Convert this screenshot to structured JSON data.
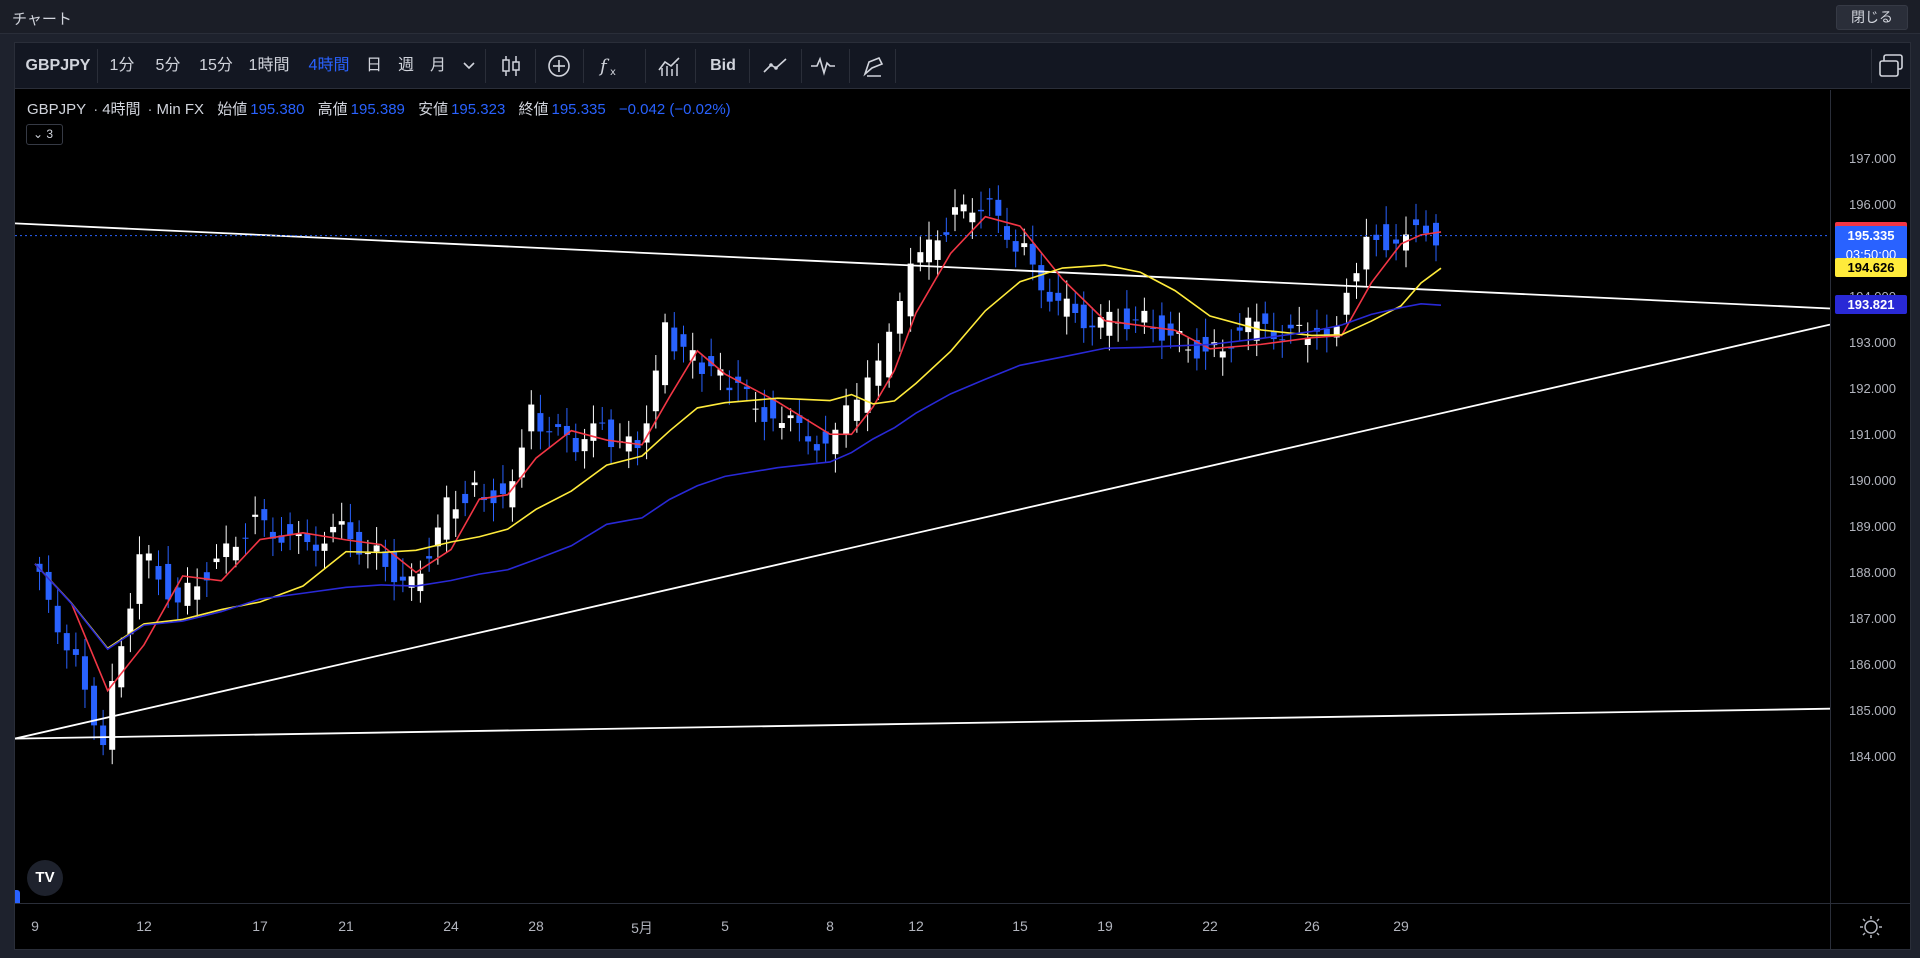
{
  "window": {
    "title": "チャート",
    "close_label": "閉じる"
  },
  "toolbar": {
    "symbol": "GBPJPY",
    "intervals": [
      "1分",
      "5分",
      "15分",
      "1時間",
      "4時間",
      "日",
      "週",
      "月"
    ],
    "active_interval": "4時間",
    "icons": [
      "chevron-down-icon",
      "candles-icon",
      "add-indicator-icon",
      "function-icon",
      "chart-type-icon",
      "bid-button",
      "trend-icon",
      "compare-icon",
      "drawing-icon",
      "layout-icon"
    ],
    "bid_label": "Bid"
  },
  "legend": {
    "symbol": "GBPJPY",
    "interval": "4時間",
    "source": "Min FX",
    "open_label": "始値",
    "open": "195.380",
    "high_label": "高値",
    "high": "195.389",
    "low_label": "安値",
    "low": "195.323",
    "close_label": "終値",
    "close": "195.335",
    "change": "−0.042 (−0.02%)",
    "collapse_count": "3"
  },
  "price_axis": {
    "ticks": [
      "197.000",
      "196.000",
      "195.000",
      "194.000",
      "193.000",
      "192.000",
      "191.000",
      "190.000",
      "189.000",
      "188.000",
      "187.000",
      "186.000",
      "185.000",
      "184.000"
    ],
    "tags": [
      {
        "label": "195.415",
        "color": "#f23645",
        "price": 195.415
      },
      {
        "label": "195.335",
        "sub": "03:50:00",
        "color": "#2962ff",
        "price": 195.335
      },
      {
        "label": "194.626",
        "color": "#ffeb3b",
        "price": 194.626
      },
      {
        "label": "193.821",
        "color": "#2929d6",
        "price": 193.821
      }
    ]
  },
  "time_axis": {
    "ticks": [
      "9",
      "12",
      "17",
      "21",
      "24",
      "28",
      "5月",
      "5",
      "8",
      "12",
      "15",
      "19",
      "22",
      "26",
      "29"
    ]
  },
  "chart_data": {
    "type": "line",
    "symbol": "GBPJPY",
    "interval": "4時間",
    "ylim": [
      183.7,
      197.5
    ],
    "grid": false,
    "price_path": [
      {
        "x": "9",
        "y": 188.2
      },
      {
        "x": "9",
        "y": 186.5
      },
      {
        "x": "9",
        "y": 184.4
      },
      {
        "x": "12",
        "y": 188.5
      },
      {
        "x": "12",
        "y": 187.4
      },
      {
        "x": "12",
        "y": 188.3
      },
      {
        "x": "17",
        "y": 189.2
      },
      {
        "x": "17",
        "y": 188.6
      },
      {
        "x": "21",
        "y": 188.9
      },
      {
        "x": "21",
        "y": 188.4
      },
      {
        "x": "21",
        "y": 187.7
      },
      {
        "x": "24",
        "y": 189.4
      },
      {
        "x": "24",
        "y": 189.9
      },
      {
        "x": "24",
        "y": 189.6
      },
      {
        "x": "28",
        "y": 191.5
      },
      {
        "x": "28",
        "y": 190.8
      },
      {
        "x": "28",
        "y": 191.1
      },
      {
        "x": "5月",
        "y": 190.6
      },
      {
        "x": "5月",
        "y": 193.2
      },
      {
        "x": "5月",
        "y": 192.6
      },
      {
        "x": "5",
        "y": 192.2
      },
      {
        "x": "5",
        "y": 191.4
      },
      {
        "x": "8",
        "y": 190.8
      },
      {
        "x": "8",
        "y": 191.4
      },
      {
        "x": "8",
        "y": 192.0
      },
      {
        "x": "8",
        "y": 193.0
      },
      {
        "x": "12",
        "y": 194.5
      },
      {
        "x": "12",
        "y": 195.6
      },
      {
        "x": "12",
        "y": 196.1
      },
      {
        "x": "15",
        "y": 195.2
      },
      {
        "x": "15",
        "y": 193.8
      },
      {
        "x": "19",
        "y": 193.4
      },
      {
        "x": "19",
        "y": 193.6
      },
      {
        "x": "19",
        "y": 193.2
      },
      {
        "x": "22",
        "y": 192.8
      },
      {
        "x": "22",
        "y": 193.4
      },
      {
        "x": "26",
        "y": 193.1
      },
      {
        "x": "26",
        "y": 193.5
      },
      {
        "x": "26",
        "y": 195.4
      },
      {
        "x": "29",
        "y": 195.2
      },
      {
        "x": "29",
        "y": 195.8
      },
      {
        "x": "29",
        "y": 195.335
      }
    ],
    "lines": [
      {
        "name": "",
        "color": "#f23645",
        "last": 195.415
      },
      {
        "name": "",
        "color": "#ffeb3b",
        "last": 194.626
      },
      {
        "name": "",
        "color": "#2929d6",
        "last": 193.821
      }
    ],
    "trendlines": [
      {
        "from": {
          "x": "9",
          "y": 195.6
        },
        "to": {
          "x": "29",
          "y": 193.75
        },
        "color": "#ffffff"
      },
      {
        "from": {
          "x": "9",
          "y": 184.4
        },
        "to": {
          "x": "29",
          "y": 193.4
        },
        "color": "#ffffff"
      },
      {
        "from": {
          "x": "9",
          "y": 184.4
        },
        "to": {
          "x": "29",
          "y": 185.05
        },
        "color": "#ffffff"
      }
    ],
    "last_price": 195.335
  }
}
